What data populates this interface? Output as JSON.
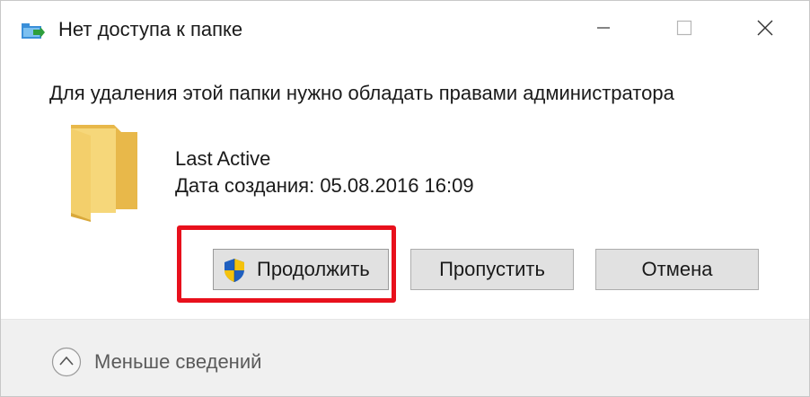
{
  "window": {
    "title": "Нет доступа к папке",
    "title_icon": "folder-move-icon",
    "controls": [
      "minimize-icon",
      "maximize-icon",
      "close-icon"
    ]
  },
  "message": {
    "heading": "Для удаления этой папки нужно обладать правами администратора"
  },
  "item": {
    "icon": "folder-icon",
    "name": "Last Active",
    "date": "Дата создания: 05.08.2016 16:09"
  },
  "buttons": {
    "continue_label": "Продолжить",
    "continue_icon": "uac-shield-icon",
    "skip_label": "Пропустить",
    "cancel_label": "Отмена"
  },
  "footer": {
    "toggle_label": "Меньше сведений",
    "toggle_icon": "chevron-up-icon"
  },
  "colors": {
    "highlight": "#e8101c",
    "folder": "#f3cf6b",
    "button_face": "#e1e1e1",
    "footer_bg": "#f0f0f0"
  }
}
